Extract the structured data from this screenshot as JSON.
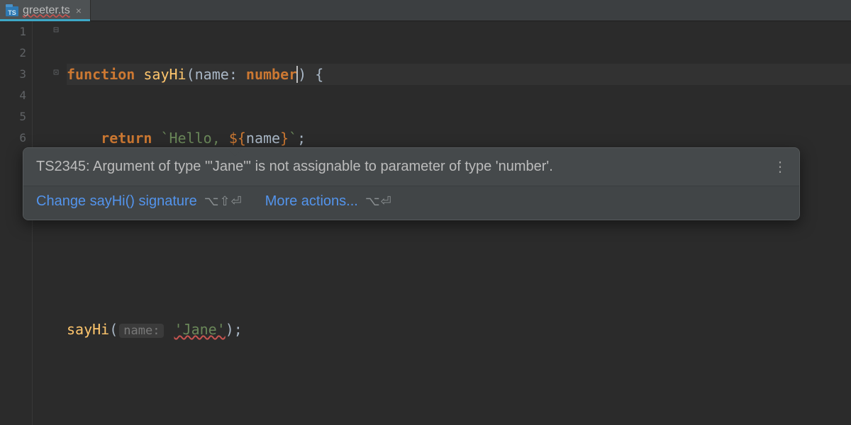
{
  "tab": {
    "filename": "greeter.ts",
    "close_glyph": "×",
    "icon_label": "TS"
  },
  "gutter": {
    "lines": [
      "1",
      "2",
      "3",
      "4",
      "5",
      "6"
    ]
  },
  "code": {
    "l1": {
      "kw": "function",
      "fn": "sayHi",
      "open": "(",
      "param": "name",
      "colon": ": ",
      "type": "number",
      "close": ")",
      "brace": " {"
    },
    "l2": {
      "kw": "return",
      "btick1": "`",
      "s1": "Hello, ",
      "tmplO": "${",
      "var": "name",
      "tmplC": "}",
      "btick2": "`",
      "semi": ";"
    },
    "l3": {
      "brace": "}"
    },
    "l5": {
      "call": "sayHi",
      "open": "(",
      "hint": "name:",
      "arg": "'Jane'",
      "close": ");"
    }
  },
  "tooltip": {
    "message": "TS2345: Argument of type '\"Jane\"' is not assignable to parameter of type 'number'.",
    "more_glyph": "⋮",
    "action1": {
      "label": "Change sayHi() signature",
      "shortcut": "⌥⇧⏎"
    },
    "action2": {
      "label": "More actions...",
      "shortcut": "⌥⏎"
    }
  }
}
